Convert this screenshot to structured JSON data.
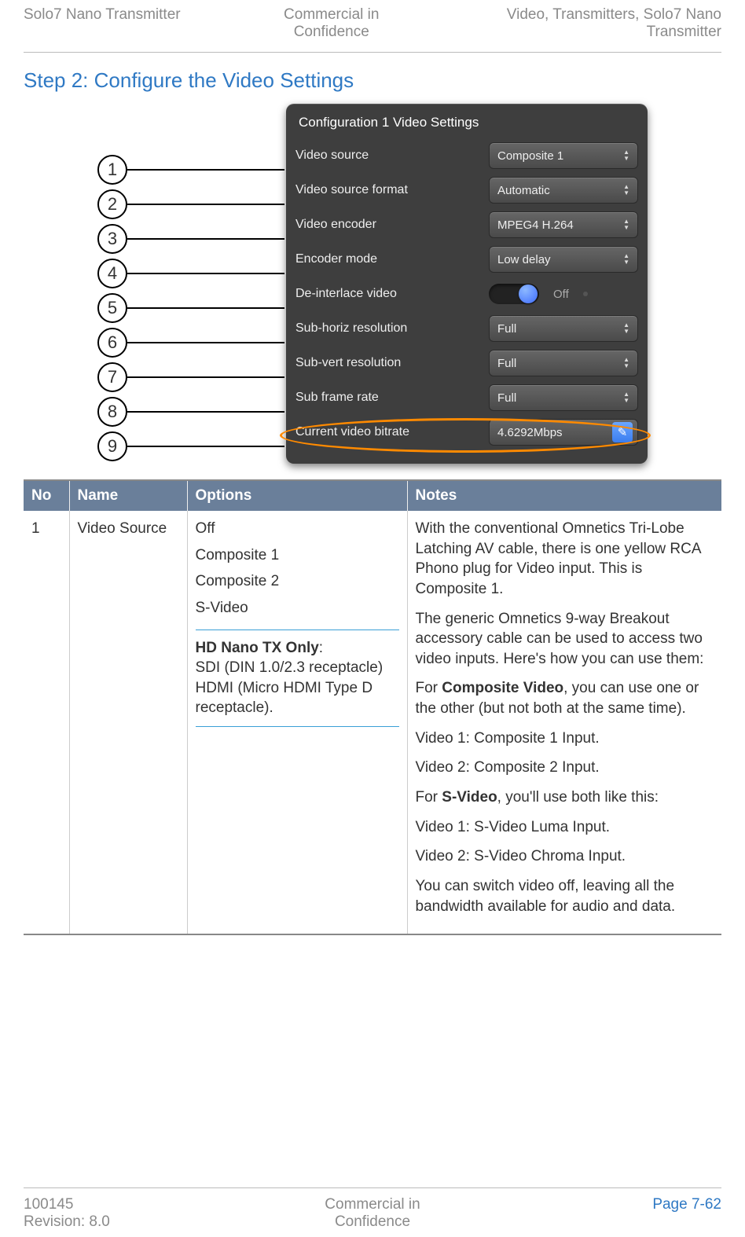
{
  "header": {
    "left": "Solo7 Nano Transmitter",
    "center_line1": "Commercial in",
    "center_line2": "Confidence",
    "right_line1": "Video, Transmitters, Solo7 Nano",
    "right_line2": "Transmitter"
  },
  "step_title": "Step 2: Configure the Video Settings",
  "panel": {
    "title": "Configuration 1 Video Settings",
    "rows": [
      {
        "label": "Video source",
        "value": "Composite 1"
      },
      {
        "label": "Video source format",
        "value": "Automatic"
      },
      {
        "label": "Video encoder",
        "value": "MPEG4 H.264"
      },
      {
        "label": "Encoder mode",
        "value": "Low delay"
      },
      {
        "label": "De-interlace video",
        "value": "Off"
      },
      {
        "label": "Sub-horiz resolution",
        "value": "Full"
      },
      {
        "label": "Sub-vert resolution",
        "value": "Full"
      },
      {
        "label": "Sub frame rate",
        "value": "Full"
      },
      {
        "label": "Current video bitrate",
        "value": "4.6292Mbps"
      }
    ]
  },
  "callouts": [
    "1",
    "2",
    "3",
    "4",
    "5",
    "6",
    "7",
    "8",
    "9"
  ],
  "table": {
    "headers": {
      "no": "No",
      "name": "Name",
      "options": "Options",
      "notes": "Notes"
    },
    "row1": {
      "no": "1",
      "name": "Video Source",
      "options_basic": [
        "Off",
        "Composite 1",
        "Composite 2",
        "S-Video"
      ],
      "options_hd_title": "HD Nano TX Only",
      "options_hd": [
        "SDI (DIN 1.0/2.3 receptacle)",
        "HDMI (Micro HDMI Type D receptacle)."
      ],
      "notes": [
        "With the conventional Omnetics Tri-Lobe Latching AV cable, there is one yellow RCA Phono plug for Video input. This is Composite 1.",
        "The generic Omnetics 9-way Breakout accessory cable can be used to access two video inputs. Here's how you can use them:",
        "For <b>Composite Video</b>, you can use one or the other (but not both at the same time).",
        "Video 1: Composite 1 Input.",
        "Video 2: Composite 2 Input.",
        "For <b>S-Video</b>, you'll use both like this:",
        "Video 1: S-Video Luma Input.",
        "Video 2: S-Video Chroma Input.",
        "You can switch video off, leaving all the bandwidth available for audio and data."
      ]
    }
  },
  "footer": {
    "left_line1": "100145",
    "left_line2": "Revision: 8.0",
    "center_line1": "Commercial in",
    "center_line2": "Confidence",
    "right": "Page 7-62"
  }
}
